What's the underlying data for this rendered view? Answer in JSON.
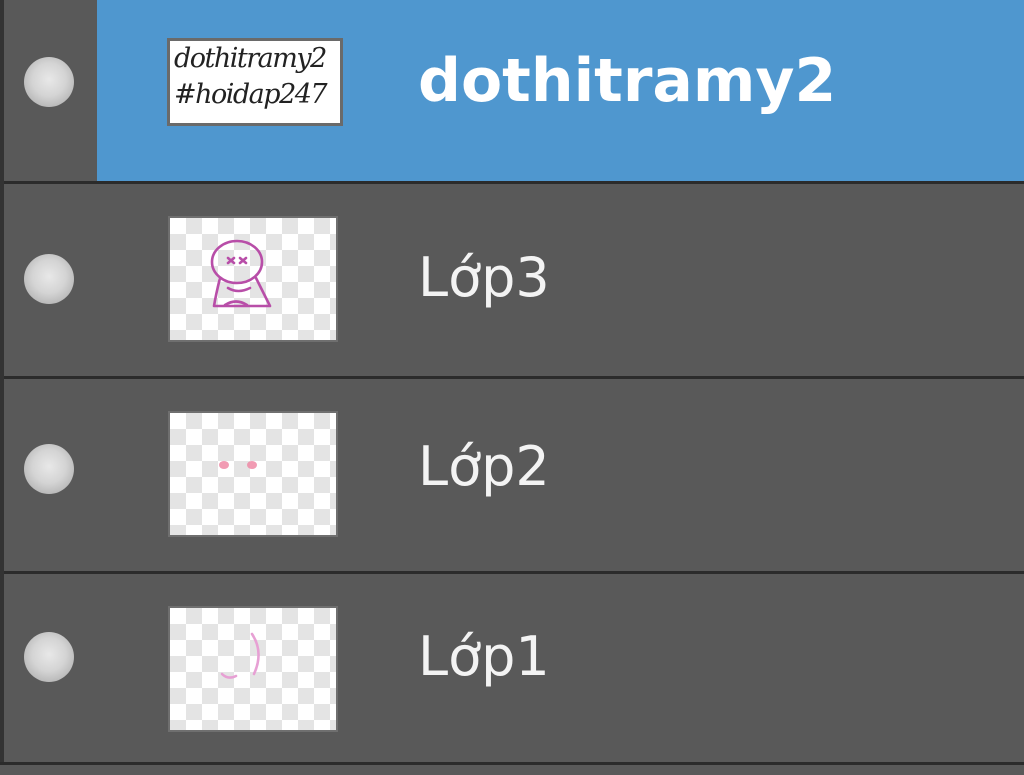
{
  "layers_panel": {
    "selected_index": 0,
    "colors": {
      "row_background": "#595959",
      "selected_background": "#4f97cf",
      "separator": "#2b2b2b",
      "text": "#f3f3f3"
    },
    "layers": [
      {
        "name": "dothitramy2",
        "visible": true,
        "selected": true,
        "thumbnail": {
          "type": "text-layer",
          "lines": [
            "dothitramy2",
            "#hoidap247"
          ]
        }
      },
      {
        "name": "Lớp3",
        "visible": true,
        "selected": false,
        "thumbnail": {
          "type": "raster",
          "content_icon": "pink-character-sketch-icon"
        }
      },
      {
        "name": "Lớp2",
        "visible": true,
        "selected": false,
        "thumbnail": {
          "type": "raster",
          "content_icon": "pink-dots-icon"
        }
      },
      {
        "name": "Lớp1",
        "visible": true,
        "selected": false,
        "thumbnail": {
          "type": "raster",
          "content_icon": "pink-stroke-icon"
        }
      }
    ]
  }
}
